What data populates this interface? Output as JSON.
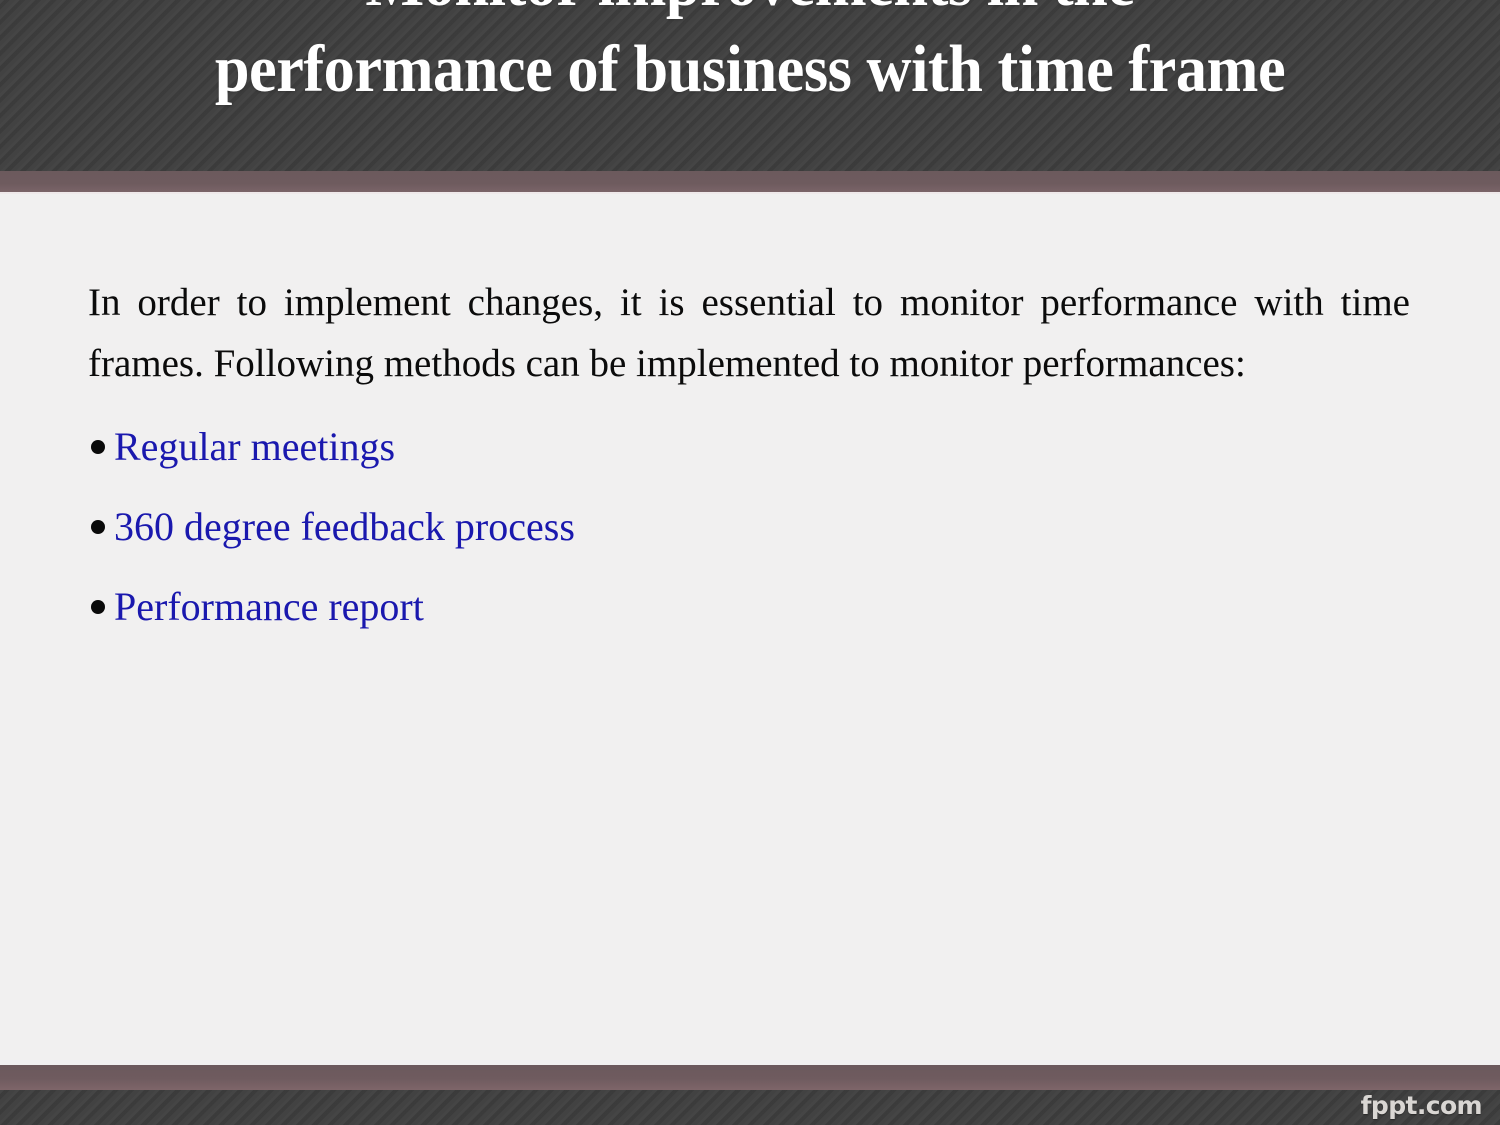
{
  "slide": {
    "title": "Monitor improvements in the performance of business with time frame",
    "intro_paragraph": "In order to implement changes, it is essential to monitor performance with time frames. Following methods can be implemented to monitor performances:",
    "bullets": [
      {
        "label": "Regular meetings"
      },
      {
        "label": "360 degree feedback process"
      },
      {
        "label": "Performance report"
      }
    ],
    "watermark": "fppt.com"
  },
  "theme": {
    "band_dark": "#3e3e3e",
    "band_mauve": "#6c5a5d",
    "body_background": "#f1f0f0",
    "title_color": "#ffffff",
    "body_text_color": "#0b0b0b",
    "bullet_text_color": "#1a18ae",
    "bullet_marker_color": "#0a0a0a",
    "watermark_color": "#d9d6d3"
  }
}
